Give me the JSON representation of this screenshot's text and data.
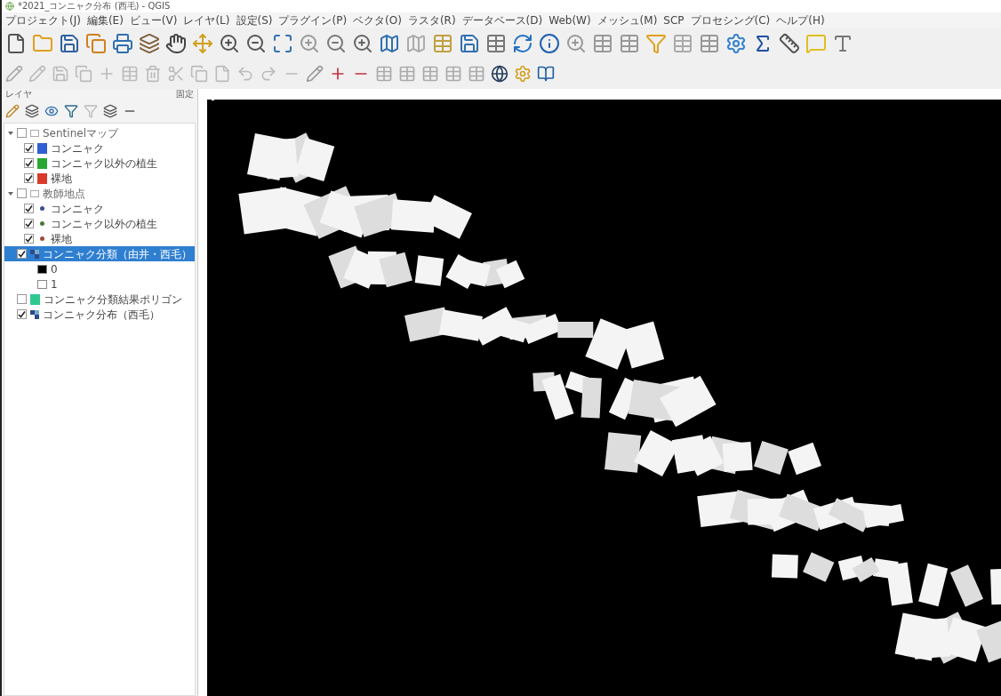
{
  "window": {
    "title": "*2021_コンニャク分布 (西毛) - QGIS"
  },
  "menu": [
    "プロジェクト(J)",
    "編集(E)",
    "ビュー(V)",
    "レイヤ(L)",
    "設定(S)",
    "プラグイン(P)",
    "ベクタ(O)",
    "ラスタ(R)",
    "データベース(D)",
    "Web(W)",
    "メッシュ(M)",
    "SCP",
    "プロセシング(C)",
    "ヘルプ(H)"
  ],
  "layers_panel": {
    "title": "レイヤ",
    "title_2": "固定",
    "tree": [
      {
        "kind": "group",
        "label": "Sentinelマップ",
        "checked": false,
        "expanded": true,
        "children": [
          {
            "kind": "class",
            "label": "コンニャク",
            "checked": true,
            "color": "#2f5fd0"
          },
          {
            "kind": "class",
            "label": "コンニャク以外の植生",
            "checked": true,
            "color": "#28a832"
          },
          {
            "kind": "class",
            "label": "裸地",
            "checked": true,
            "color": "#d83a2c"
          }
        ]
      },
      {
        "kind": "group",
        "label": "教師地点",
        "checked": false,
        "expanded": true,
        "children": [
          {
            "kind": "point",
            "label": "コンニャク",
            "checked": true,
            "color": "#3a4f8c"
          },
          {
            "kind": "point",
            "label": "コンニャク以外の植生",
            "checked": true,
            "color": "#4a7a3a"
          },
          {
            "kind": "point",
            "label": "裸地",
            "checked": true,
            "color": "#a04a3a"
          }
        ]
      },
      {
        "kind": "raster",
        "label": "コンニャク分類（由井・西毛）",
        "checked": true,
        "selected": true,
        "children": [
          {
            "kind": "legend",
            "label": "0",
            "color": "#000000"
          },
          {
            "kind": "legend",
            "label": "1",
            "color": "#ffffff"
          }
        ]
      },
      {
        "kind": "polygon",
        "label": "コンニャク分類結果ポリゴン",
        "checked": false,
        "selected": false,
        "color": "#2ec88e"
      },
      {
        "kind": "raster",
        "label": "コンニャク分布（西毛）",
        "checked": true,
        "selected": false
      }
    ]
  }
}
